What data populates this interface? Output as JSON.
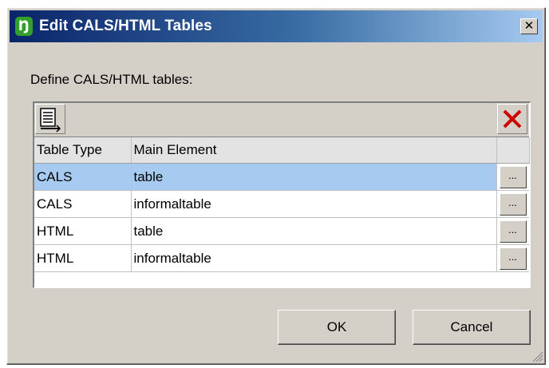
{
  "window": {
    "title": "Edit CALS/HTML Tables",
    "app_icon_glyph": "Ŋ",
    "close_glyph": "✕"
  },
  "prompt": "Define CALS/HTML tables:",
  "toolbar": {
    "append_icon": "append-row-icon",
    "delete_icon": "delete-icon",
    "delete_color": "#cc0000"
  },
  "table": {
    "columns": [
      "Table Type",
      "Main Element"
    ],
    "rows": [
      {
        "type": "CALS",
        "element": "table",
        "selected": true
      },
      {
        "type": "CALS",
        "element": "informaltable",
        "selected": false
      },
      {
        "type": "HTML",
        "element": "table",
        "selected": false
      },
      {
        "type": "HTML",
        "element": "informaltable",
        "selected": false
      }
    ],
    "row_button_label": "..."
  },
  "buttons": {
    "ok": "OK",
    "cancel": "Cancel"
  },
  "colors": {
    "title_start": "#0a246a",
    "title_end": "#a6caf0",
    "selection": "#a6caf0",
    "face": "#d4d0c8"
  }
}
